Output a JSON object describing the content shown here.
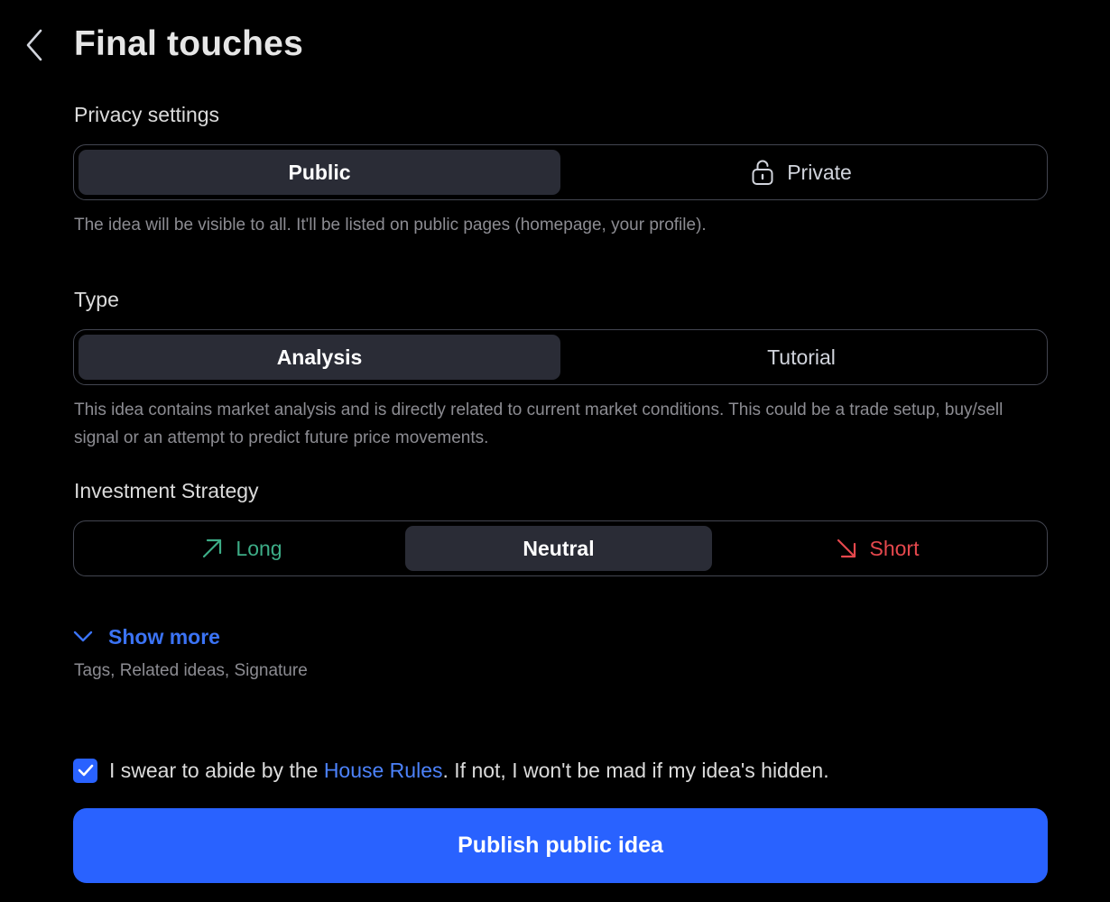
{
  "header": {
    "title": "Final touches"
  },
  "privacy": {
    "label": "Privacy settings",
    "options": [
      {
        "label": "Public",
        "active": true
      },
      {
        "label": "Private",
        "active": false,
        "icon": "lock-icon"
      }
    ],
    "help": "The idea will be visible to all. It'll be listed on public pages (homepage, your profile)."
  },
  "type": {
    "label": "Type",
    "options": [
      {
        "label": "Analysis",
        "active": true
      },
      {
        "label": "Tutorial",
        "active": false
      }
    ],
    "help": "This idea contains market analysis and is directly related to current market conditions. This could be a trade setup, buy/sell signal or an attempt to predict future price movements."
  },
  "strategy": {
    "label": "Investment Strategy",
    "options": [
      {
        "label": "Long",
        "active": false,
        "icon": "arrow-up-right-icon",
        "color": "#3dad87"
      },
      {
        "label": "Neutral",
        "active": true
      },
      {
        "label": "Short",
        "active": false,
        "icon": "arrow-down-right-icon",
        "color": "#e5484d"
      }
    ]
  },
  "show_more": {
    "label": "Show more",
    "subtitle": "Tags, Related ideas, Signature"
  },
  "rules": {
    "checked": true,
    "prefix": "I swear to abide by the ",
    "link": "House Rules",
    "suffix": ". If not, I won't be mad if my idea's hidden."
  },
  "publish": {
    "label": "Publish public idea"
  },
  "colors": {
    "accent": "#2962ff",
    "link": "#3b73f5",
    "long": "#3dad87",
    "short": "#e5484d",
    "background": "#000000",
    "active_segment": "#2a2c36"
  }
}
